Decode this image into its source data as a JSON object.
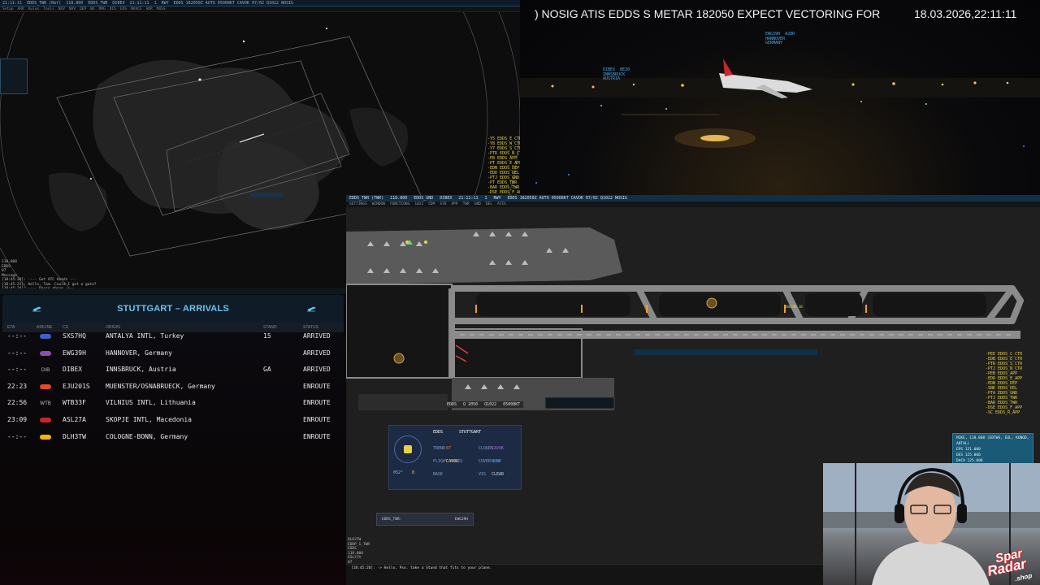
{
  "radar": {
    "menubar": [
      "21:11:11",
      "EDDS_TWR (Ref)",
      "118.800",
      "EDDS_TWR",
      "DIBEX",
      "21:11:11",
      "1",
      "RWY",
      "EDDS 182050Z AUTO 05008KT CAVOK 07/02 Q1022 NOSIG"
    ],
    "toolbar": [
      "Setup",
      "ARR",
      "Rules",
      "Tools",
      "NAV",
      "NAV",
      "DEP",
      "WX",
      "MRG",
      "DIS",
      "EDS",
      "NAVCE",
      "ADR",
      "MUSS"
    ],
    "messages": [
      "118.800",
      "EDDS",
      "07",
      "Message",
      "[18:45:20]: ---- Got ATC Heads ---",
      "[18:45:21]: Hello, Tam. Could I get a gate?",
      "[18:45:24]: ---- Pause above ----"
    ],
    "yellow_stack": [
      "-Y5 EDDS_E_CTR",
      "-Y8 EDDS_W_CTR",
      "-Y7 EDDS_S_CTR",
      "-PTR EDDS_N_CTR",
      "-P8 EDDS_APP",
      "-PT EDDS_E_APP",
      "-EDN EDDS_DEP",
      "-EDD EDDS_DEL",
      "-PTJ EDDS_GND",
      "-PT EDDS_TWR",
      "-BAR EDDS_TWR",
      "-DSE EDDS_F_APP",
      "-SC EDDS_R_APP"
    ]
  },
  "arrivals": {
    "title": "STUTTGART – ARRIVALS",
    "columns": {
      "eta": "ETA",
      "airline": "AIRLINE",
      "cs": "CS",
      "origin": "ORIGIN",
      "stand": "STAND",
      "status": "STATUS"
    },
    "rows": [
      {
        "eta": "--:--",
        "airline": "",
        "cs": "SXS7HQ",
        "origin": "ANTALYA INTL, Turkey",
        "stand": "15",
        "status": "ARRIVED",
        "logo": "#3b63c4"
      },
      {
        "eta": "--:--",
        "airline": "",
        "cs": "EWG39H",
        "origin": "HANNOVER, Germany",
        "stand": "",
        "status": "ARRIVED",
        "logo": "#8a4fb0"
      },
      {
        "eta": "--:--",
        "airline": "DIB",
        "cs": "DIBEX",
        "origin": "INNSBRUCK, Austria",
        "stand": "GA",
        "status": "ARRIVED",
        "logo": ""
      },
      {
        "eta": "22:23",
        "airline": "",
        "cs": "EJU201S",
        "origin": "MUENSTER/OSNABRUECK, Germany",
        "stand": "",
        "status": "ENROUTE",
        "logo": "#e24b2a"
      },
      {
        "eta": "22:56",
        "airline": "WTB",
        "cs": "WTB33F",
        "origin": "VILNIUS INTL, Lithuania",
        "stand": "",
        "status": "ENROUTE",
        "logo": ""
      },
      {
        "eta": "23:09",
        "airline": "",
        "cs": "ASL27A",
        "origin": "SKOPJE INTL, Macedonia",
        "stand": "",
        "status": "ENROUTE",
        "logo": "#c8272d"
      },
      {
        "eta": "--:--",
        "airline": "",
        "cs": "DLH3TW",
        "origin": "COLOGNE-BONN, Germany",
        "stand": "",
        "status": "ENROUTE",
        "logo": "#f2b705"
      }
    ]
  },
  "tower": {
    "atis": ") NOSIG ATIS EDDS S METAR 182050 EXPECT VECTORING FOR",
    "datetime": "18.03.2026,22:11:11",
    "label_1": [
      "EWG39H  A28R",
      "HANNOVER",
      "GERMANY"
    ],
    "label_2": [
      "DIBEX  BE20",
      "INNSBRUCK",
      "AUSTRIA"
    ]
  },
  "ground": {
    "titlebar": [
      "EDDS_TWR (TWR)",
      "118.800",
      "EDDS_GND",
      "DIBEX",
      "21:11:11",
      "1",
      "RWY",
      "EDDS 182050Z AUTO 05008KT CAVOK 07/02 Q1022 NOSIG"
    ],
    "toolbar": [
      "SETTINGS",
      "WINDOW",
      "FUNCTIONS",
      "1022",
      "CDM",
      "STD",
      "APP",
      "TWR",
      "GND",
      "DEL",
      "ATIS"
    ],
    "metar": [
      "EDDS",
      "Q 2050",
      "Q1022",
      "05008KT"
    ],
    "wx": {
      "station": "EDDS",
      "city": "STUTTGART",
      "rwy": "07",
      "qnh": "CAVOK",
      "wind_dir": "052°",
      "wind_spd": "8",
      "cloud": "NONE",
      "vis": "CLEAR",
      "l1": "TREND",
      "l2": "FLIGHT RULES",
      "l3": "BASE",
      "l4": "CLOUDS",
      "l5": "COVER",
      "l6": "VIS"
    },
    "input": {
      "left": "EDDS_TWR:",
      "right": "EWG39H"
    },
    "messages": [
      "DLH3TW",
      "EDDP_1_TWR",
      "EDDS",
      "118.800",
      "ASL27A",
      "07",
      "Message"
    ],
    "bottom_line": "[18:45:20]: -> Hello, Pso. take a Stand that fits to your plane.",
    "yellow_stack": [
      "-PEE EDDS_C_CTR",
      "-EDB EDDS_E_CTR",
      "-PTR EDDS_S_CTR",
      "-PTJ EDDS_N_CTR",
      "-PEB EDDS_APP",
      "-EDD EDDS_E_APP",
      "-EDN EDDS_DEP",
      "-SNE EDDS_DEL",
      "-PTA EDDS_GND",
      "-PTJ EDDS_TWR",
      "-BAR EDDS_TWR",
      "-DSE EDDS_F_APP",
      "-SC EDDS_R_APP"
    ]
  },
  "side_info": [
    "MIKE, 118.800 (EDTWS, EUL, KUNOD,",
    "ABTAL)",
    "EPS 121.000",
    "DES 125.000",
    "DACH 125.000"
  ],
  "brand": {
    "l1": "Spar",
    "l2": "Radar",
    "l3": ".shop"
  }
}
